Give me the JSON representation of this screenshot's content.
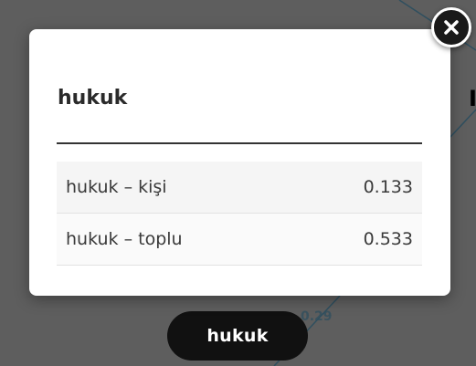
{
  "graph": {
    "node_label": "hukuk",
    "edge_value_partial": "0.29",
    "edge_color": "#2f4f5f"
  },
  "modal": {
    "title": "hukuk",
    "rows": [
      {
        "label": "hukuk – kişi",
        "value": "0.133"
      },
      {
        "label": "hukuk – toplu",
        "value": "0.533"
      }
    ],
    "close_icon": "close-icon"
  },
  "colors": {
    "overlay": "#5e5e5e",
    "modal_bg": "#ffffff",
    "pill_bg": "#111111",
    "close_bg": "#1a1a1a"
  }
}
